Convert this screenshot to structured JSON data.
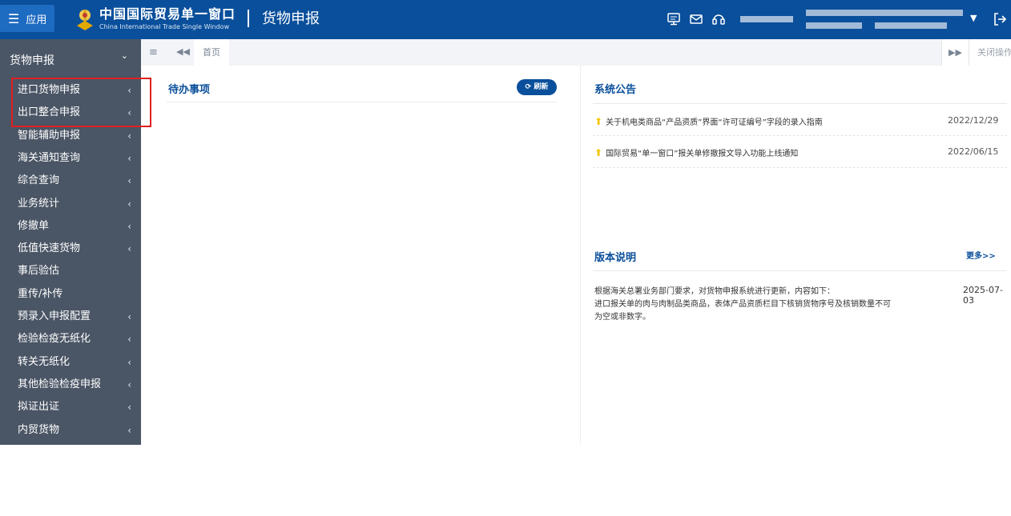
{
  "header": {
    "app_button": "应用",
    "logo_cn": "中国国际贸易单一窗口",
    "logo_en": "China International Trade Single Window",
    "module_title": "货物申报",
    "icons": [
      "monitor-icon",
      "mail-icon",
      "headset-icon",
      "logout-icon"
    ]
  },
  "sidebar": {
    "header": "货物申报",
    "items": [
      {
        "label": "进口货物申报",
        "has_submenu": true
      },
      {
        "label": "出口整合申报",
        "has_submenu": true
      },
      {
        "label": "智能辅助申报",
        "has_submenu": true
      },
      {
        "label": "海关通知查询",
        "has_submenu": true
      },
      {
        "label": "综合查询",
        "has_submenu": true
      },
      {
        "label": "业务统计",
        "has_submenu": true
      },
      {
        "label": "修撤单",
        "has_submenu": true
      },
      {
        "label": "低值快速货物",
        "has_submenu": true
      },
      {
        "label": "事后验估",
        "has_submenu": false
      },
      {
        "label": "重传/补传",
        "has_submenu": false
      },
      {
        "label": "预录入申报配置",
        "has_submenu": true
      },
      {
        "label": "检验检疫无纸化",
        "has_submenu": true
      },
      {
        "label": "转关无纸化",
        "has_submenu": true
      },
      {
        "label": "其他检验检疫申报",
        "has_submenu": true
      },
      {
        "label": "拟证出证",
        "has_submenu": true
      },
      {
        "label": "内贸货物",
        "has_submenu": true
      }
    ]
  },
  "tabs": {
    "home": "首页",
    "close_ops": "关闭操作"
  },
  "todo": {
    "title": "待办事项",
    "refresh_label": "刷新"
  },
  "announcements": {
    "title": "系统公告",
    "items": [
      {
        "text": "关于机电类商品“产品资质”界面“许可证编号”字段的录入指南",
        "date": "2022/12/29"
      },
      {
        "text": "国际贸易“单一窗口”报关单修撤报文导入功能上线通知",
        "date": "2022/06/15"
      }
    ]
  },
  "version": {
    "title": "版本说明",
    "more_label": "更多>>",
    "lines": [
      "根据海关总署业务部门要求，对货物申报系统进行更新，内容如下：",
      "进口报关单的肉与肉制品类商品，表体产品资质栏目下核销货物序号及核销数量不可",
      "为空或非数字。"
    ],
    "date": "2025-07-03"
  },
  "colors": {
    "header_bg": "#0a4f9b",
    "sidebar_bg": "#4a5565",
    "accent": "#0a4f9b",
    "highlight_box": "#e02020"
  }
}
